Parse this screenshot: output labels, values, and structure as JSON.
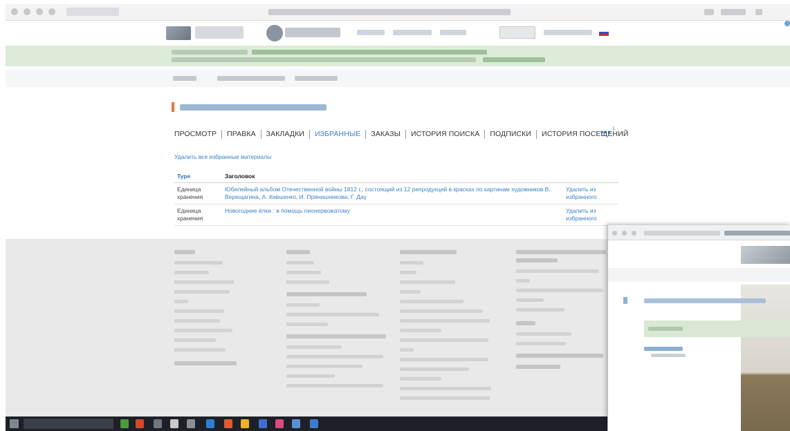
{
  "tabs": {
    "items": [
      {
        "label": "ПРОСМОТР"
      },
      {
        "label": "ПРАВКА"
      },
      {
        "label": "ЗАКЛАДКИ"
      },
      {
        "label": "ИЗБРАННЫЕ",
        "active": true
      },
      {
        "label": "ЗАКАЗЫ"
      },
      {
        "label": "ИСТОРИЯ ПОИСКА"
      },
      {
        "label": "ПОДПИСКИ"
      },
      {
        "label": "ИСТОРИЯ ПОСЕЩЕНИЙ"
      }
    ],
    "more_label": "•••",
    "more_count": "1"
  },
  "favorites": {
    "remove_all_label": "Удалить все избранные материалы",
    "columns": {
      "type": "Type",
      "title": "Заголовок"
    },
    "rows": [
      {
        "type": "Единица хранения",
        "title": "Юбилейный альбом Отечественной войны 1812 г., состоящий из 12 репродукций в красках по картинам художников В. Верещагина, А. Кившенко, И. Прянишникова, Г. Дау",
        "action": "Удалить из избранного"
      },
      {
        "type": "Единица хранения",
        "title": "Новогодние ёлки : в помощь пионервожатому",
        "action": "Удалить из избранного"
      }
    ]
  },
  "colors": {
    "link": "#3a7fc4",
    "active_tab": "#3a7fc4",
    "banner": "#dcecd9",
    "footer": "#e9e9e9",
    "taskbar": "#1d2127"
  }
}
